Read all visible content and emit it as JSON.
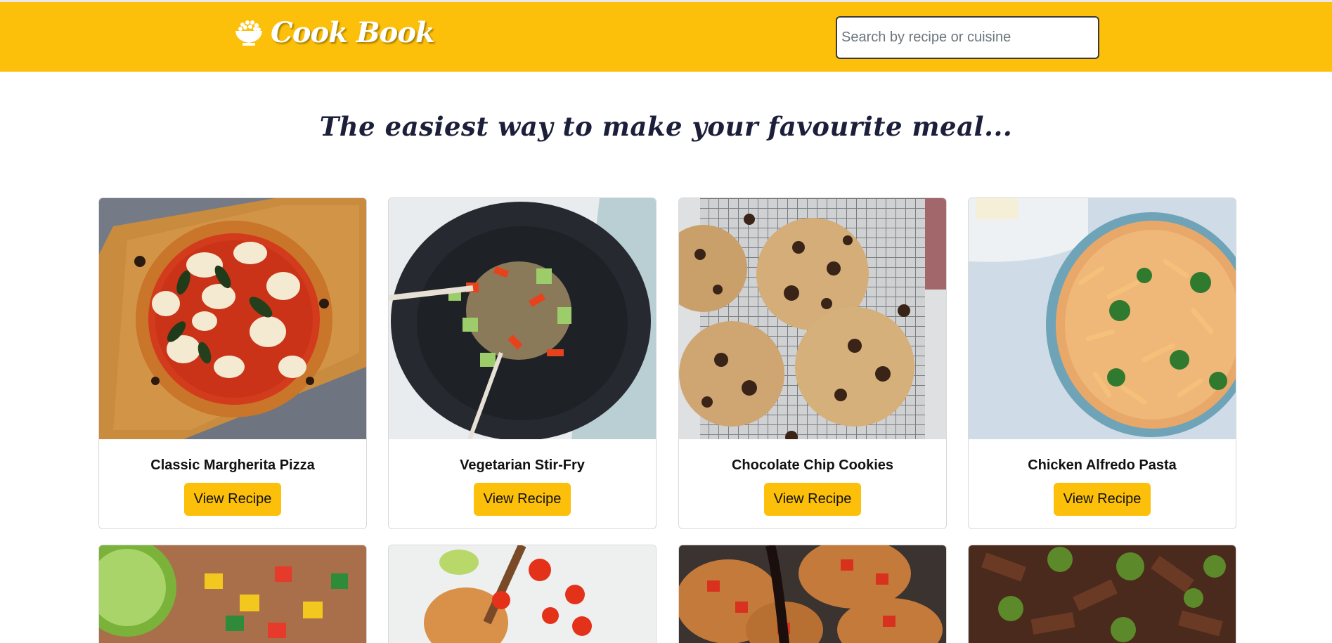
{
  "header": {
    "brand_name": "Cook Book",
    "brand_icon": "rice-bowl-icon",
    "search_placeholder": "Search by recipe or cuisine",
    "search_value": ""
  },
  "tagline": "The easiest way to make your favourite meal...",
  "recipes": [
    {
      "title": "Classic Margherita Pizza",
      "button": "View Recipe",
      "image": "margherita-pizza-image"
    },
    {
      "title": "Vegetarian Stir-Fry",
      "button": "View Recipe",
      "image": "stir-fry-image"
    },
    {
      "title": "Chocolate Chip Cookies",
      "button": "View Recipe",
      "image": "chocolate-chip-cookies-image"
    },
    {
      "title": "Chicken Alfredo Pasta",
      "button": "View Recipe",
      "image": "alfredo-pasta-image"
    }
  ],
  "recipes_row2": [
    {
      "image": "mango-salsa-image"
    },
    {
      "image": "dressing-tomatoes-image"
    },
    {
      "image": "bruschetta-image"
    },
    {
      "image": "beef-broccoli-image"
    }
  ],
  "colors": {
    "accent": "#fcbf0a",
    "text": "#212529"
  }
}
